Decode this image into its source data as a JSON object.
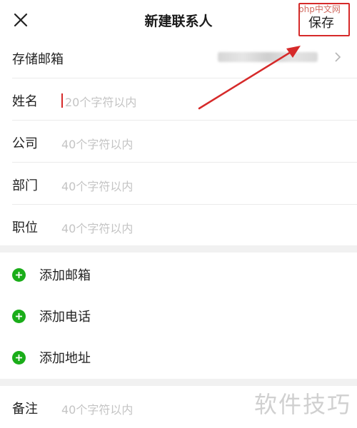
{
  "header": {
    "title": "新建联系人",
    "save_label": "保存"
  },
  "storage": {
    "label": "存储邮箱"
  },
  "fields": [
    {
      "label": "姓名",
      "placeholder": "20个字符以内"
    },
    {
      "label": "公司",
      "placeholder": "40个字符以内"
    },
    {
      "label": "部门",
      "placeholder": "40个字符以内"
    },
    {
      "label": "职位",
      "placeholder": "40个字符以内"
    }
  ],
  "adds": [
    {
      "label": "添加邮箱"
    },
    {
      "label": "添加电话"
    },
    {
      "label": "添加地址"
    }
  ],
  "note": {
    "label": "备注",
    "placeholder": "40个字符以内"
  },
  "watermarks": {
    "top": "php中文网",
    "bottom": "软件技巧"
  },
  "colors": {
    "accent_green": "#1aad19",
    "annotation_red": "#d62a2a"
  },
  "icons": {
    "close": "close-icon",
    "chevron": "chevron-right-icon",
    "add": "plus-circle-icon"
  }
}
